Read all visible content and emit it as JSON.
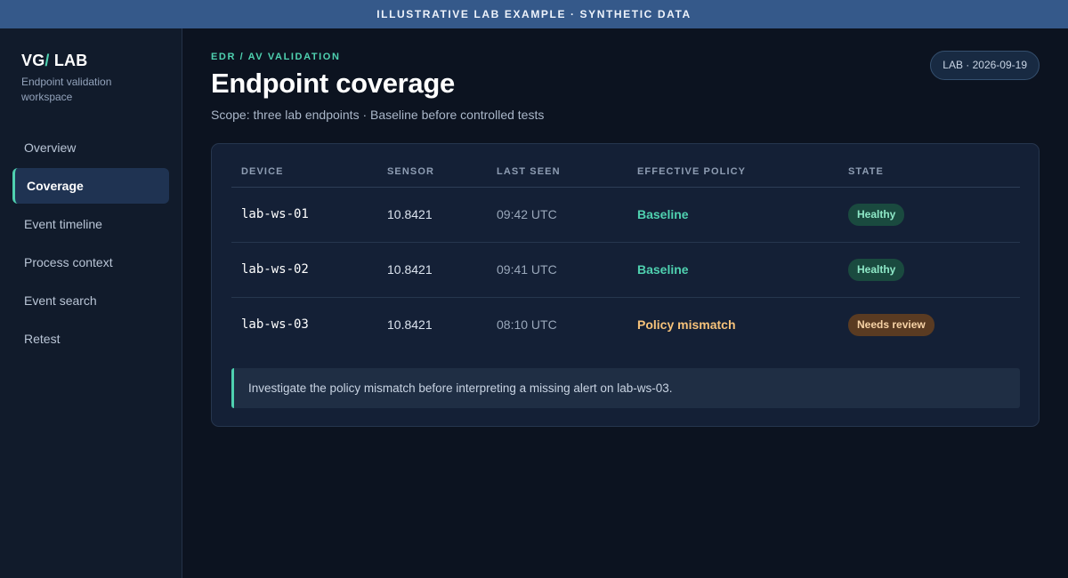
{
  "banner": {
    "text": "ILLUSTRATIVE LAB EXAMPLE · SYNTHETIC DATA"
  },
  "sidebar": {
    "brand_main": "VG",
    "brand_slash": "/",
    "brand_rest": " LAB",
    "subtitle": "Endpoint validation workspace",
    "items": [
      {
        "label": "Overview",
        "active": false
      },
      {
        "label": "Coverage",
        "active": true
      },
      {
        "label": "Event timeline",
        "active": false
      },
      {
        "label": "Process context",
        "active": false
      },
      {
        "label": "Event search",
        "active": false
      },
      {
        "label": "Retest",
        "active": false
      }
    ]
  },
  "header": {
    "eyebrow": "EDR / AV VALIDATION",
    "title": "Endpoint coverage",
    "scope": "Scope: three lab endpoints · Baseline before controlled tests",
    "lab_badge": "LAB · 2026-09-19"
  },
  "table": {
    "columns": [
      "DEVICE",
      "SENSOR",
      "LAST SEEN",
      "EFFECTIVE POLICY",
      "STATE"
    ],
    "rows": [
      {
        "device": "lab-ws-01",
        "sensor": "10.8421",
        "last_seen": "09:42 UTC",
        "policy": "Baseline",
        "state": "Healthy"
      },
      {
        "device": "lab-ws-02",
        "sensor": "10.8421",
        "last_seen": "09:41 UTC",
        "policy": "Baseline",
        "state": "Healthy"
      },
      {
        "device": "lab-ws-03",
        "sensor": "10.8421",
        "last_seen": "08:10 UTC",
        "policy": "Policy mismatch",
        "state": "Needs review"
      }
    ]
  },
  "note": {
    "text": "Investigate the policy mismatch before interpreting a missing alert on lab-ws-03."
  },
  "colors": {
    "accent": "#4fd1b0",
    "warning": "#f6c27a",
    "banner": "#35598a",
    "background": "#0c1320"
  }
}
